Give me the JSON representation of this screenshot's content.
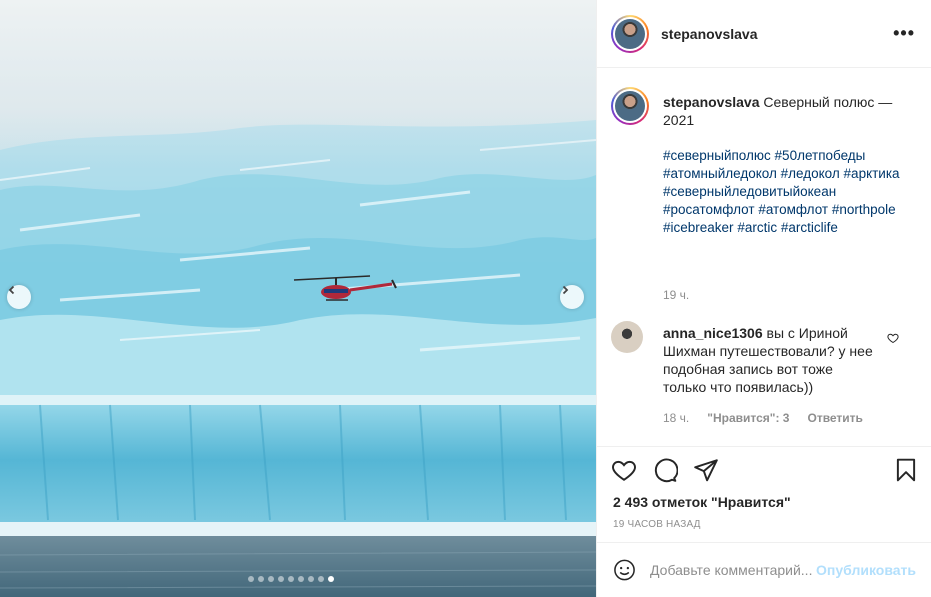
{
  "post": {
    "username": "stepanovslava",
    "more_label": "•••",
    "caption": {
      "username": "stepanovslava",
      "text": "Северный полюс — 2021",
      "hashtags": [
        "#северныйполюс",
        "#50летпобеды",
        "#атомныйледокол",
        "#ледокол",
        "#арктика",
        "#северныйледовитыйокеан",
        "#росатомфлот",
        "#атомфлот",
        "#northpole",
        "#icebreaker",
        "#arctic",
        "#arcticlife"
      ],
      "time": "19 ч."
    },
    "comments": [
      {
        "username": "anna_nice1306",
        "text": "вы с Ириной Шихман путешествовали? у нее подобная запись вот тоже только что появилась))",
        "time": "18 ч.",
        "likes": "\"Нравится\": 3",
        "reply": "Ответить"
      }
    ],
    "likes_text": "2 493 отметок \"Нравится\"",
    "post_time": "19 ЧАСОВ НАЗАД",
    "comment_placeholder": "Добавьте комментарий...",
    "publish_label": "Опубликовать"
  },
  "carousel": {
    "slides": 9,
    "active": 8
  },
  "icons": {
    "prev": "chevron-left-icon",
    "next": "chevron-right-icon",
    "like": "heart-icon",
    "comment": "comment-icon",
    "share": "paper-plane-icon",
    "save": "bookmark-icon",
    "emoji": "smiley-icon"
  },
  "colors": {
    "link": "#00376b",
    "publish": "#b2dffc",
    "muted": "#8e8e8e"
  }
}
